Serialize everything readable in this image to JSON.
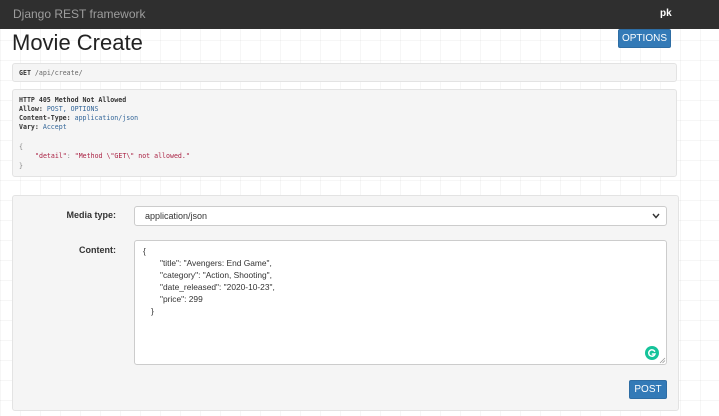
{
  "navbar": {
    "brand": "Django REST framework",
    "user": "pk"
  },
  "page": {
    "title": "Movie Create",
    "options_label": "OPTIONS"
  },
  "request": {
    "method": "GET",
    "url": "/api/create/"
  },
  "response": {
    "status_line": "HTTP 405 Method Not Allowed",
    "headers": [
      {
        "name": "Allow:",
        "value": "POST, OPTIONS"
      },
      {
        "name": "Content-Type:",
        "value": "application/json"
      },
      {
        "name": "Vary:",
        "value": "Accept"
      }
    ],
    "body": {
      "open": "{",
      "key": "\"detail\"",
      "colon": ": ",
      "value": "\"Method \\\"GET\\\" not allowed.\"",
      "close": "}"
    }
  },
  "form": {
    "media_type_label": "Media type:",
    "media_type_value": "application/json",
    "content_label": "Content:",
    "content_lines": [
      "{",
      "\"title\": \"Avengers: End Game\",",
      "\"category\": \"Action, Shooting\",",
      "\"date_released\": \"2020-10-23\",",
      "\"price\": 299",
      "}"
    ],
    "post_label": "POST"
  },
  "icons": {
    "select": "chevron-down-icon",
    "textarea": "grammarly-icon"
  },
  "colors": {
    "navbar": "#2f2f2f",
    "primary": "#337ab7",
    "grammarly": "#15c39a"
  }
}
